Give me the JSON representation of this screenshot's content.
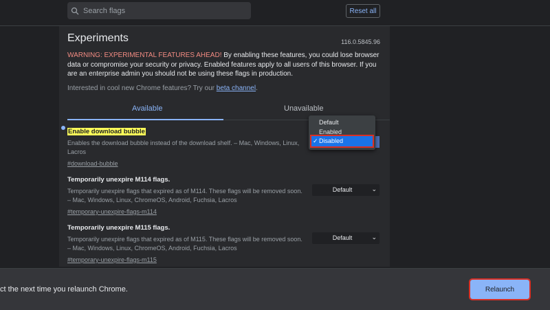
{
  "search": {
    "placeholder": "Search flags"
  },
  "header": {
    "reset_label": "Reset all"
  },
  "page": {
    "title": "Experiments",
    "version": "116.0.5845.96",
    "warning_prefix": "WARNING: EXPERIMENTAL FEATURES AHEAD!",
    "warning_body": " By enabling these features, you could lose browser data or compromise your security or privacy. Enabled features apply to all users of this browser. If you are an enterprise admin you should not be using these flags in production.",
    "interest_text": "Interested in cool new Chrome features? Try our ",
    "beta_link": "beta channel",
    "interest_suffix": "."
  },
  "tabs": [
    {
      "label": "Available"
    },
    {
      "label": "Unavailable"
    }
  ],
  "flags": [
    {
      "title": "Enable download bubble",
      "desc": "Enables the download bubble instead of the download shelf. – Mac, Windows, Linux, Lacros",
      "link": "#download-bubble",
      "value": "Disabled"
    },
    {
      "title": "Temporarily unexpire M114 flags.",
      "desc": "Temporarily unexpire flags that expired as of M114. These flags will be removed soon. – Mac, Windows, Linux, ChromeOS, Android, Fuchsia, Lacros",
      "link": "#temporary-unexpire-flags-m114",
      "value": "Default"
    },
    {
      "title": "Temporarily unexpire M115 flags.",
      "desc": "Temporarily unexpire flags that expired as of M115. These flags will be removed soon. – Mac, Windows, Linux, ChromeOS, Android, Fuchsia, Lacros",
      "link": "#temporary-unexpire-flags-m115",
      "value": "Default"
    }
  ],
  "dropdown": {
    "options": [
      "Default",
      "Enabled",
      "Disabled"
    ],
    "selected": "Disabled",
    "check": "✓"
  },
  "bottom": {
    "message": "ct the next time you relaunch Chrome.",
    "relaunch_label": "Relaunch"
  },
  "colors": {
    "accent": "#8ab4f8",
    "warning": "#f28b82",
    "highlight": "#ffff59",
    "annotation": "#d93025"
  }
}
